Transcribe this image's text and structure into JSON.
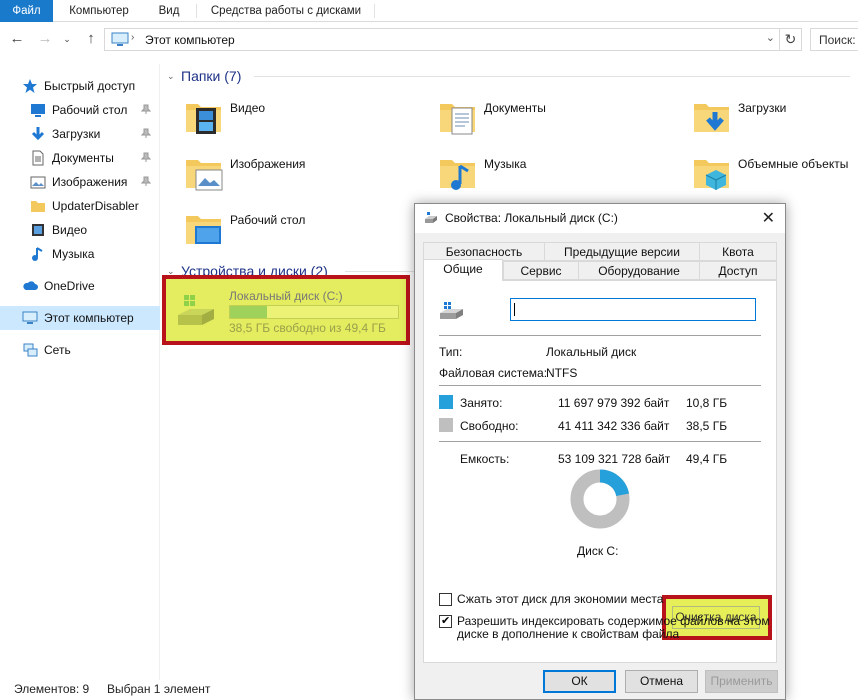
{
  "ribbon": {
    "tabs": [
      {
        "label": "Файл"
      },
      {
        "label": "Компьютер"
      },
      {
        "label": "Вид"
      },
      {
        "label": "Средства работы с дисками"
      }
    ]
  },
  "nav": {
    "address": "Этот компьютер",
    "search_placeholder": "Поиск:"
  },
  "sidebar": {
    "items": [
      {
        "label": "Быстрый доступ",
        "icon": "star-icon"
      },
      {
        "label": "Рабочий стол",
        "icon": "desktop-icon",
        "pinned": true
      },
      {
        "label": "Загрузки",
        "icon": "download-icon",
        "pinned": true
      },
      {
        "label": "Документы",
        "icon": "document-icon",
        "pinned": true
      },
      {
        "label": "Изображения",
        "icon": "image-icon",
        "pinned": true
      },
      {
        "label": "UpdaterDisabler",
        "icon": "folder-icon"
      },
      {
        "label": "Видео",
        "icon": "video-icon"
      },
      {
        "label": "Музыка",
        "icon": "music-icon"
      },
      {
        "label": "OneDrive",
        "icon": "cloud-icon"
      },
      {
        "label": "Этот компьютер",
        "icon": "computer-icon",
        "selected": true
      },
      {
        "label": "Сеть",
        "icon": "network-icon"
      }
    ]
  },
  "main": {
    "folders_header": "Папки (7)",
    "folders": [
      {
        "label": "Видео",
        "icon": "video-folder-icon"
      },
      {
        "label": "Документы",
        "icon": "documents-folder-icon"
      },
      {
        "label": "Загрузки",
        "icon": "downloads-folder-icon"
      },
      {
        "label": "Изображения",
        "icon": "images-folder-icon"
      },
      {
        "label": "Музыка",
        "icon": "music-folder-icon"
      },
      {
        "label": "Объемные объекты",
        "icon": "3d-objects-folder-icon"
      },
      {
        "label": "Рабочий стол",
        "icon": "desktop-folder-icon"
      }
    ],
    "devices_header": "Устройства и диски (2)",
    "drive": {
      "name": "Локальный диск (C:)",
      "free_text": "38,5 ГБ свободно из 49,4 ГБ",
      "used_fraction": 0.22
    }
  },
  "status": {
    "items_count": "Элементов: 9",
    "selected": "Выбран 1 элемент"
  },
  "dialog": {
    "title": "Свойства: Локальный диск (C:)",
    "tabs_row1": [
      "Безопасность",
      "Предыдущие версии",
      "Квота"
    ],
    "tabs_row2": [
      "Общие",
      "Сервис",
      "Оборудование",
      "Доступ"
    ],
    "name_value": "",
    "type_label": "Тип:",
    "type_value": "Локальный диск",
    "fs_label": "Файловая система:",
    "fs_value": "NTFS",
    "used_label": "Занято:",
    "used_bytes": "11 697 979 392 байт",
    "used_size": "10,8 ГБ",
    "free_label": "Свободно:",
    "free_bytes": "41 411 342 336 байт",
    "free_size": "38,5 ГБ",
    "capacity_label": "Емкость:",
    "capacity_bytes": "53 109 321 728 байт",
    "capacity_size": "49,4 ГБ",
    "disk_label": "Диск C:",
    "cleanup_button": "Очистка диска",
    "compress_label": "Сжать этот диск для экономии места",
    "compress_checked": false,
    "index_label_line1": "Разрешить индексировать содержимое файлов на этом",
    "index_label_line2": "диске в дополнение к свойствам файла",
    "index_checked": true,
    "ok_button": "ОК",
    "cancel_button": "Отмена",
    "apply_button": "Применить",
    "colors": {
      "used": "#26a0da",
      "free": "#bfbfbf"
    },
    "used_fraction": 0.22
  },
  "colors": {
    "accent": "#1979ca",
    "selection": "#cce8ff",
    "highlight": "#e4ec5f",
    "highlight_border": "#b8121a",
    "folder": "#f3c85d",
    "group_header": "#1e3287"
  }
}
